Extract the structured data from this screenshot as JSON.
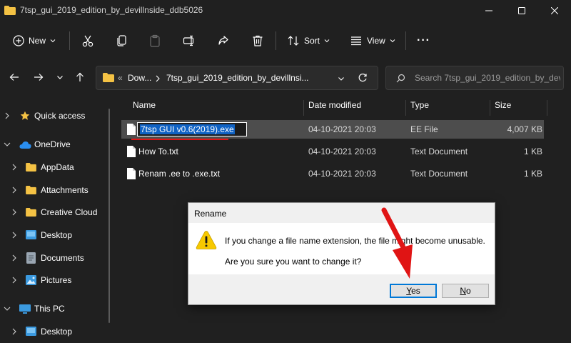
{
  "window": {
    "title": "7tsp_gui_2019_edition_by_devillnside_ddb5026"
  },
  "toolbar": {
    "new_label": "New",
    "sort_label": "Sort",
    "view_label": "View",
    "more_label": "···"
  },
  "address": {
    "crumb_1": "Dow...",
    "crumb_2": "7tsp_gui_2019_edition_by_devillnsi...",
    "overflow": "«"
  },
  "search": {
    "placeholder": "Search 7tsp_gui_2019_edition_by_devil..."
  },
  "sidebar": {
    "items": [
      {
        "label": "Quick access"
      },
      {
        "label": "OneDrive"
      },
      {
        "label": "AppData"
      },
      {
        "label": "Attachments"
      },
      {
        "label": "Creative Cloud"
      },
      {
        "label": "Desktop"
      },
      {
        "label": "Documents"
      },
      {
        "label": "Pictures"
      },
      {
        "label": "This PC"
      },
      {
        "label": "Desktop"
      }
    ]
  },
  "columns": {
    "name": "Name",
    "date": "Date modified",
    "type": "Type",
    "size": "Size"
  },
  "files": [
    {
      "name": "7tsp GUI v0.6(2019).exe",
      "date": "04-10-2021 20:03",
      "type": "EE File",
      "size": "4,007 KB"
    },
    {
      "name": "How To.txt",
      "date": "04-10-2021 20:03",
      "type": "Text Document",
      "size": "1 KB"
    },
    {
      "name": "Renam .ee to .exe.txt",
      "date": "04-10-2021 20:03",
      "type": "Text Document",
      "size": "1 KB"
    }
  ],
  "dialog": {
    "title": "Rename",
    "message_1": "If you change a file name extension, the file might become unusable.",
    "message_2": "Are you sure you want to change it?",
    "yes_label": "Yes",
    "yes_accel": "Y",
    "yes_rest": "es",
    "no_label": "No",
    "no_accel": "N",
    "no_rest": "o"
  },
  "colors": {
    "background": "#202020",
    "selection": "#4d4d4d",
    "accent": "#0078d7",
    "annotation_red": "#e01414",
    "folder_yellow": "#f4c244",
    "warning_yellow": "#f7c900"
  }
}
